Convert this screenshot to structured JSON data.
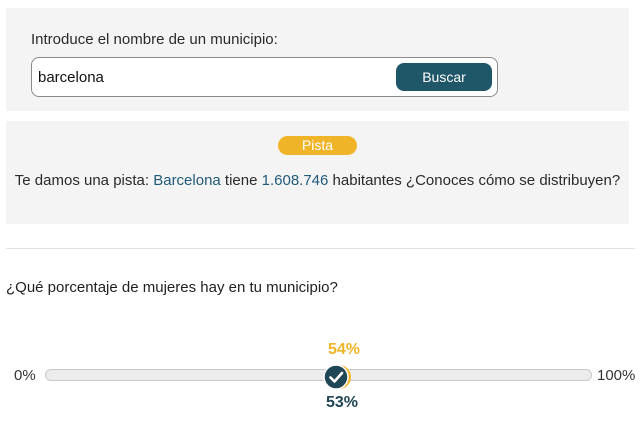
{
  "search": {
    "label": "Introduce el nombre de un municipio:",
    "value": "barcelona",
    "button_label": "Buscar"
  },
  "hint": {
    "badge": "Pista",
    "text_prefix": "Te damos una pista: ",
    "city": "Barcelona",
    "text_middle": " tiene ",
    "population": "1.608.746",
    "text_suffix": " habitantes ¿Conoces cómo se distribuyen?"
  },
  "quiz": {
    "question": "¿Qué porcentaje de mujeres hay en tu municipio?",
    "slider_min": "0%",
    "slider_max": "100%",
    "guess_label": "54%",
    "actual_label": "53%",
    "guess_value": 54,
    "actual_value": 53
  },
  "colors": {
    "accent": "#1f5668",
    "highlight": "#f0b429",
    "hint_text": "#1f5a7a"
  },
  "icons": {
    "marker": "check-icon"
  }
}
